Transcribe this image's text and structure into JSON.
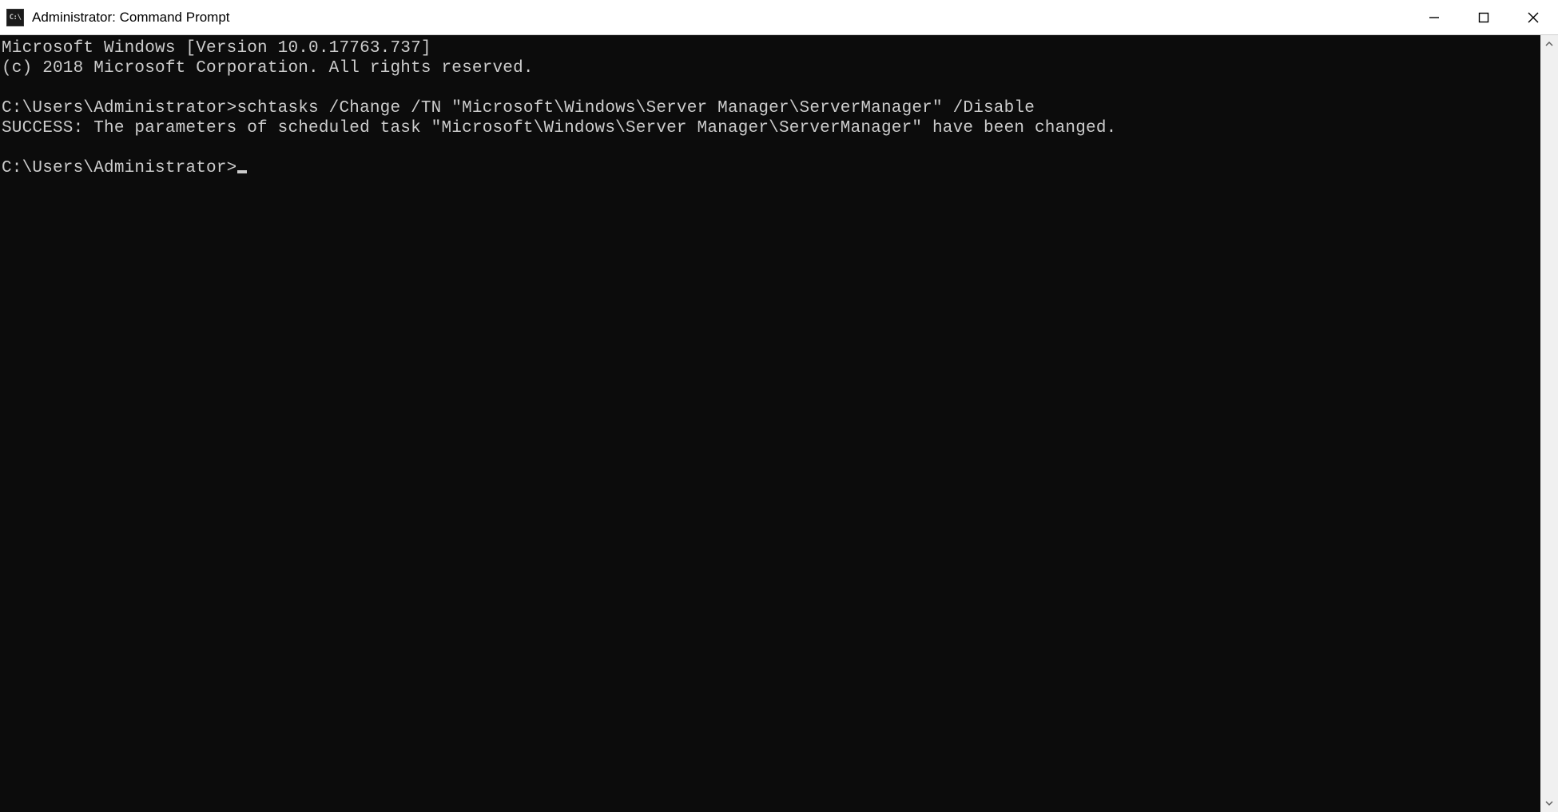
{
  "window": {
    "title": "Administrator: Command Prompt",
    "icon_label": "C:\\"
  },
  "terminal": {
    "lines": [
      "Microsoft Windows [Version 10.0.17763.737]",
      "(c) 2018 Microsoft Corporation. All rights reserved.",
      "",
      "C:\\Users\\Administrator>schtasks /Change /TN \"Microsoft\\Windows\\Server Manager\\ServerManager\" /Disable",
      "SUCCESS: The parameters of scheduled task \"Microsoft\\Windows\\Server Manager\\ServerManager\" have been changed.",
      ""
    ],
    "prompt": "C:\\Users\\Administrator>"
  }
}
